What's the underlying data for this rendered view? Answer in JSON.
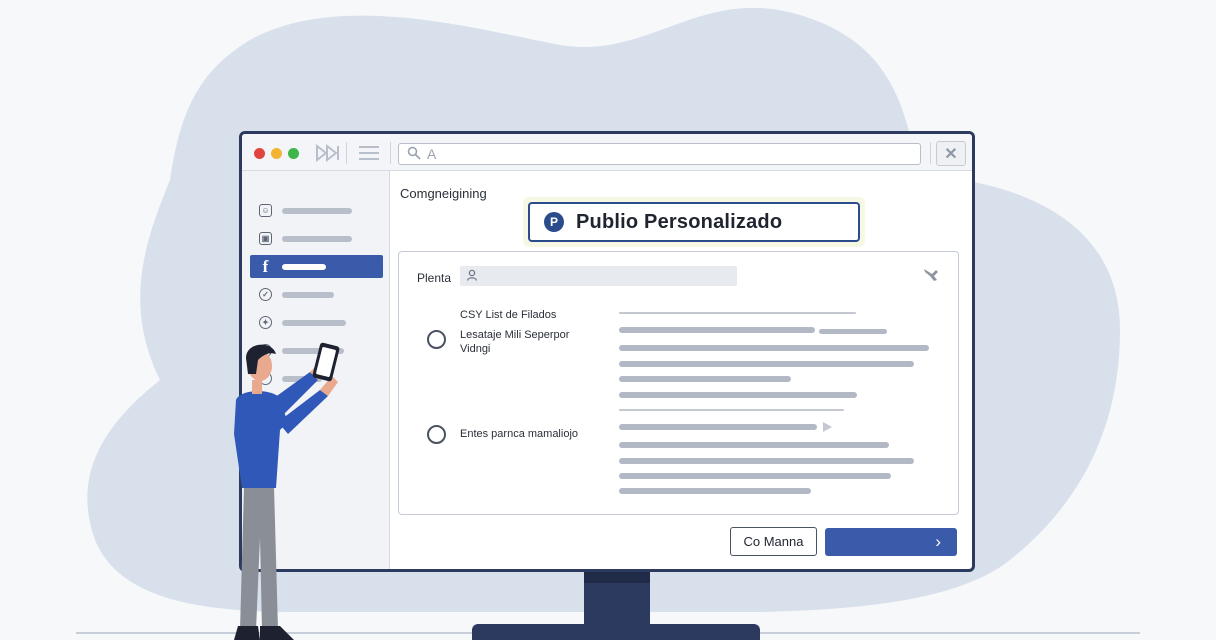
{
  "colors": {
    "accent": "#3a5ba9",
    "monitor_frame": "#2b3a5e",
    "background_blob": "#d8e0ec",
    "shirt": "#2f58b8"
  },
  "browser": {
    "search_placeholder": "A",
    "icons": [
      "forward-icon",
      "menu-icon",
      "search-icon",
      "close-icon"
    ]
  },
  "sidebar": {
    "items": [
      {
        "icon": "smile-icon",
        "label_hidden": true
      },
      {
        "icon": "camera-icon",
        "label_hidden": true
      },
      {
        "icon": "facebook-icon",
        "active": true
      },
      {
        "icon": "check-icon"
      },
      {
        "icon": "bird-icon"
      },
      {
        "icon": "generic-icon"
      },
      {
        "icon": "generic-icon"
      }
    ],
    "facebook_glyph": "f"
  },
  "main": {
    "title": "Comgneigining",
    "badge": {
      "logo_letter": "P",
      "text": "Publio Personalizado"
    },
    "panel": {
      "field_label": "Plenta",
      "options_heading": "CSY List de Filados",
      "options": [
        {
          "label": "Lesataje Mili Seperpor Vidngi"
        },
        {
          "label": "Entes parnca mamaliojo"
        }
      ]
    },
    "buttons": {
      "secondary": "Co Manna",
      "primary_icon": "›"
    }
  }
}
